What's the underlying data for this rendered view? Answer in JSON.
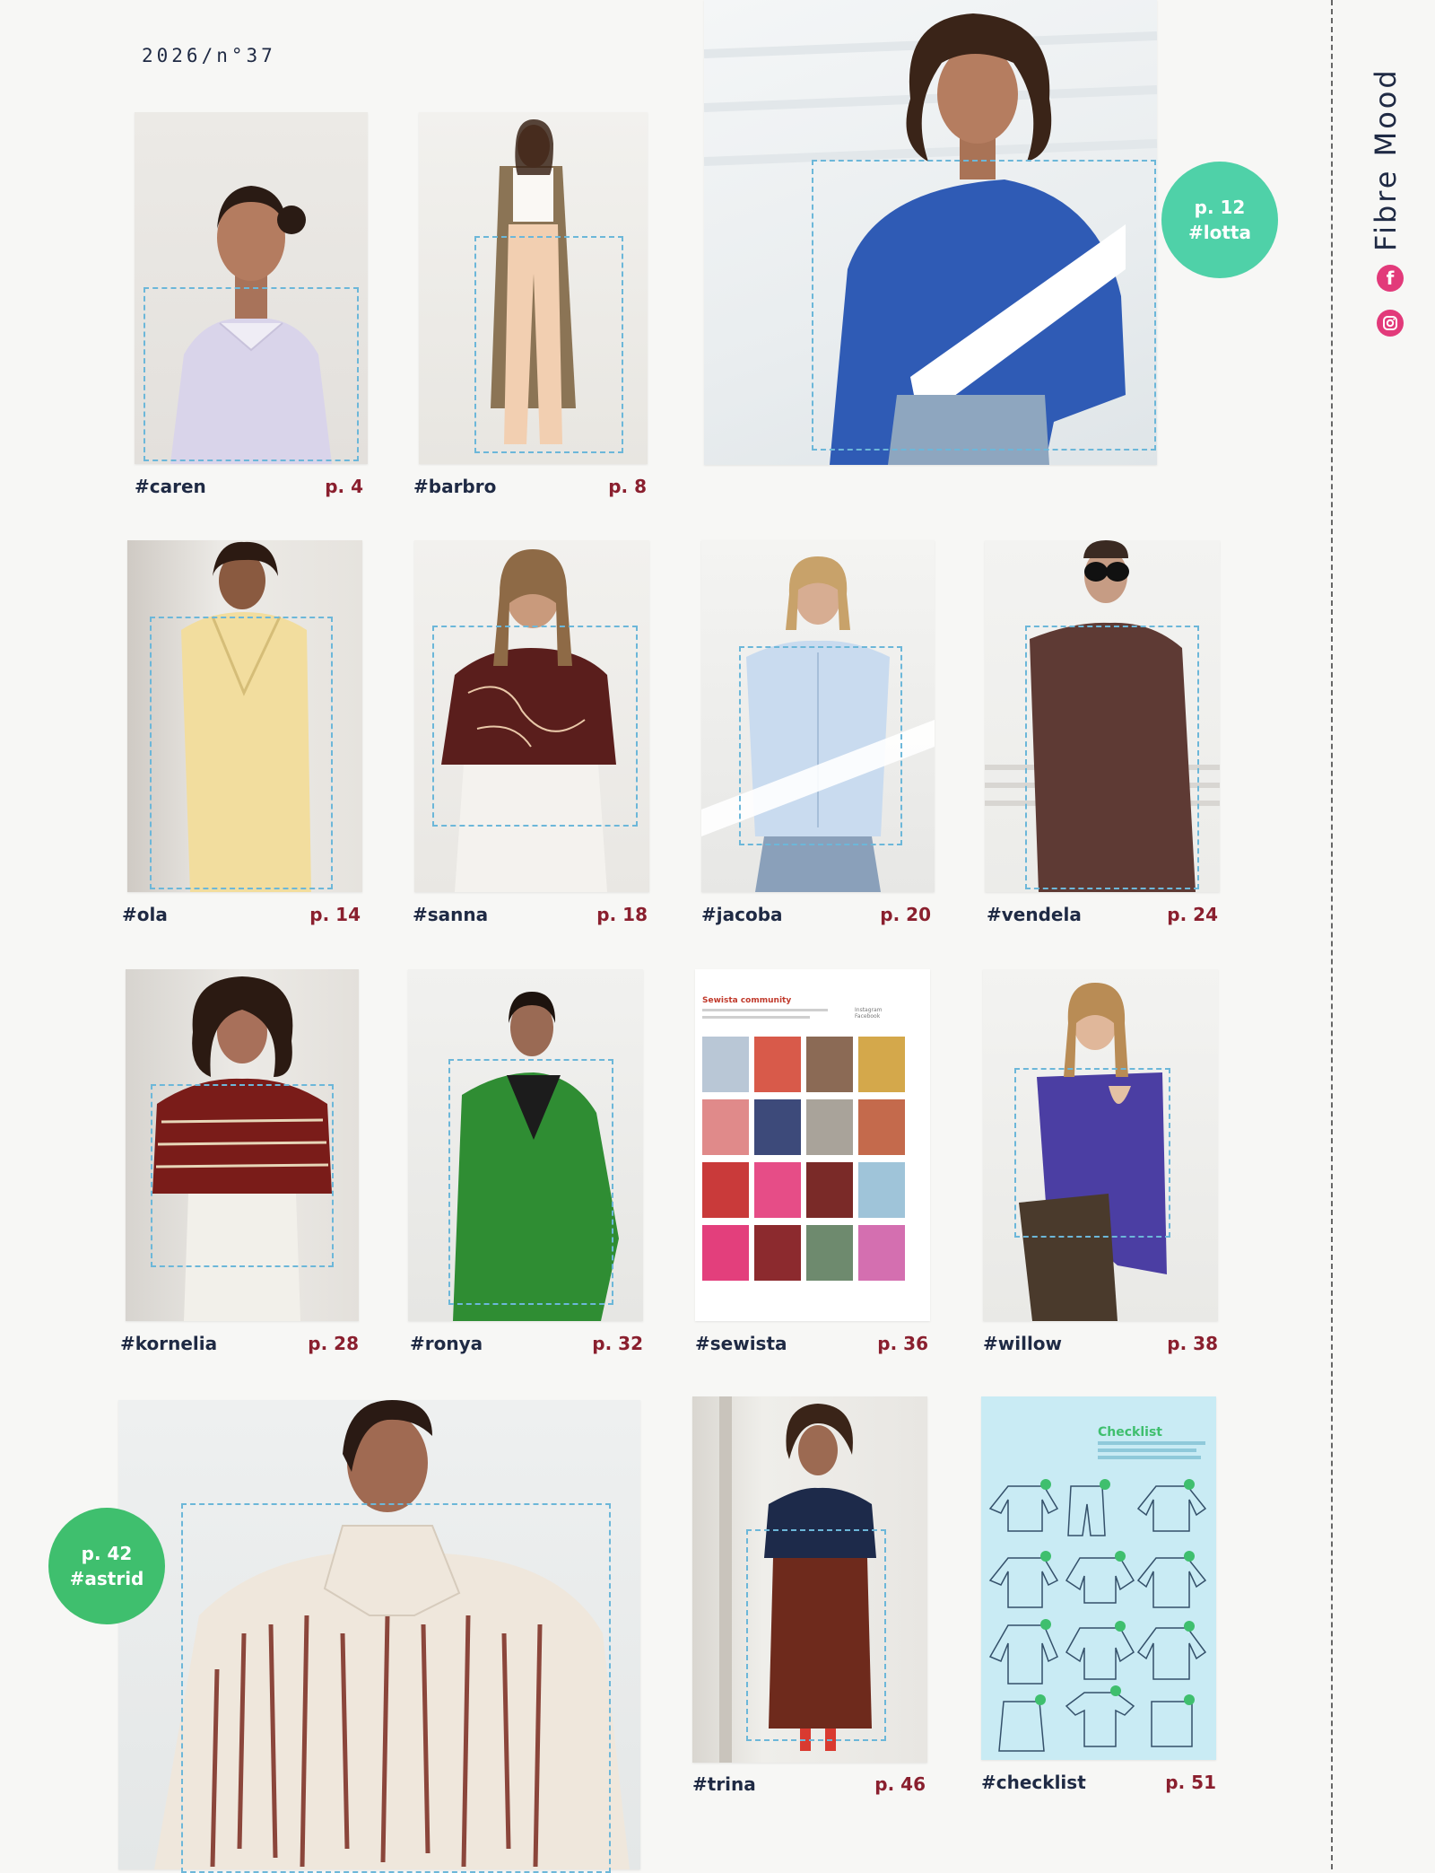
{
  "issue": "2026/n°37",
  "brand": {
    "name": "Fibre Mood",
    "icons": [
      "facebook-icon",
      "instagram-icon"
    ],
    "icon_color": "#e23a7a"
  },
  "colors": {
    "page_number": "#8a1f2e",
    "dashes": "#6cb7d9",
    "badge_lotta": "#4fd1a8",
    "badge_astrid": "#3fbf6e"
  },
  "items": [
    {
      "tag": "#caren",
      "page": "p. 4"
    },
    {
      "tag": "#barbro",
      "page": "p. 8"
    },
    {
      "tag": "#ola",
      "page": "p. 14"
    },
    {
      "tag": "#sanna",
      "page": "p. 18"
    },
    {
      "tag": "#jacoba",
      "page": "p. 20"
    },
    {
      "tag": "#vendela",
      "page": "p. 24"
    },
    {
      "tag": "#kornelia",
      "page": "p. 28"
    },
    {
      "tag": "#ronya",
      "page": "p. 32"
    },
    {
      "tag": "#sewista",
      "page": "p. 36"
    },
    {
      "tag": "#willow",
      "page": "p. 38"
    },
    {
      "tag": "#trina",
      "page": "p. 46"
    },
    {
      "tag": "#checklist",
      "page": "p. 51"
    }
  ],
  "featured": [
    {
      "page": "p. 12",
      "tag": "#lotta"
    },
    {
      "page": "p. 42",
      "tag": "#astrid"
    }
  ],
  "sewista_thumb": {
    "title": "Sewista community",
    "legend": [
      "Instagram",
      "Facebook"
    ]
  },
  "checklist_thumb": {
    "title": "Checklist"
  }
}
